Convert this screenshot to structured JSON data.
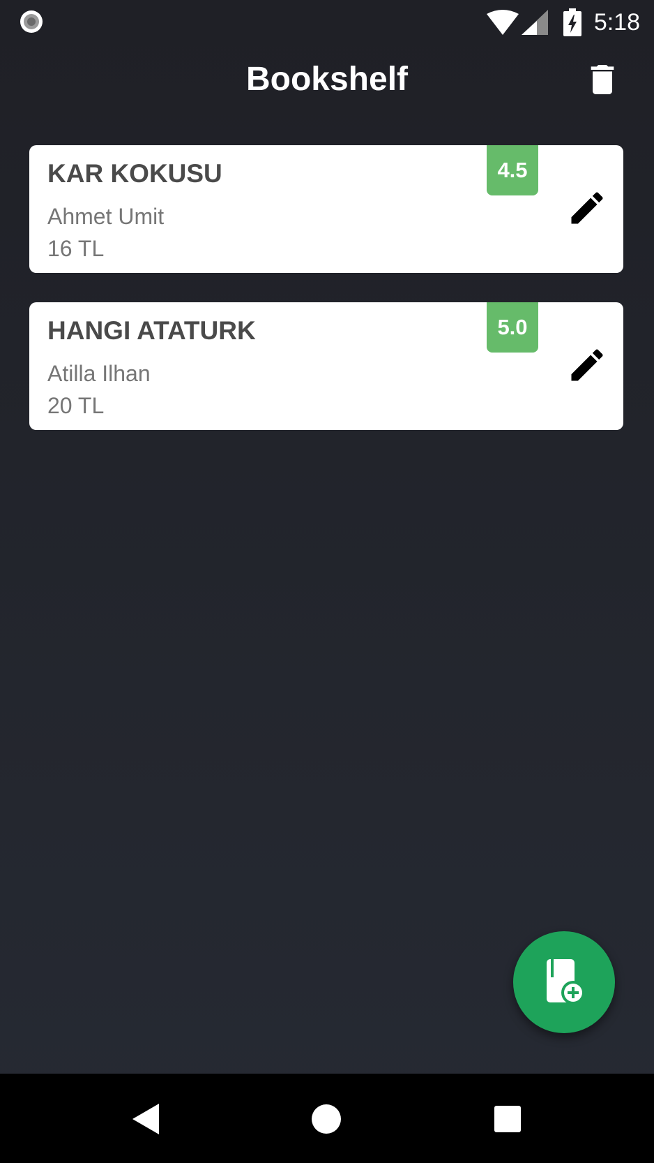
{
  "status_bar": {
    "time": "5:18",
    "icons": [
      "record-indicator-icon",
      "wifi-icon",
      "cellular-signal-icon",
      "battery-charging-icon"
    ]
  },
  "app_bar": {
    "title": "Bookshelf",
    "action_icon": "trash-icon"
  },
  "books": [
    {
      "title": "KAR KOKUSU",
      "author": "Ahmet Umit",
      "price": "16 TL",
      "rating": "4.5"
    },
    {
      "title": "HANGI ATATURK",
      "author": "Atilla Ilhan",
      "price": "20 TL",
      "rating": "5.0"
    }
  ],
  "fab": {
    "icon": "add-book-icon"
  },
  "nav_bar": {
    "icons": [
      "back-icon",
      "home-icon",
      "recents-icon"
    ]
  },
  "colors": {
    "background": "#23252c",
    "card": "#ffffff",
    "rating_badge": "#66bb6a",
    "fab": "#1ea35a",
    "title_text": "#4a4a4a",
    "secondary_text": "#767676"
  }
}
